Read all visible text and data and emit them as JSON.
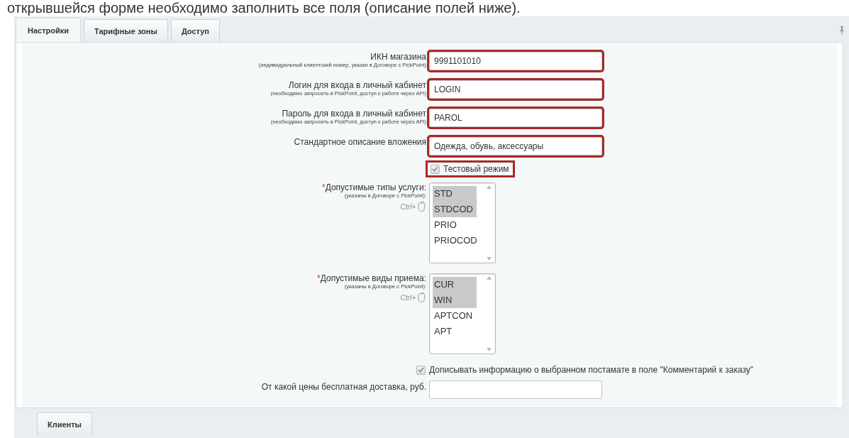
{
  "intro_text": "открывшейся форме необходимо заполнить все поля (описание полей ниже).",
  "tabs": [
    {
      "label": "Настройки",
      "selected": true
    },
    {
      "label": "Тарифные зоны",
      "selected": false
    },
    {
      "label": "Доступ",
      "selected": false
    }
  ],
  "fields": [
    {
      "label": "ИКН магазина",
      "hint": "(индивидуальный клиентский номер, указан в Договоре с PickPoint)",
      "value": "9991101010",
      "highlighted": true
    },
    {
      "label": "Логин для входа в личный кабинет",
      "hint": "(необходимо запросить в PickPoint, доступ к работе через API)",
      "value": "LOGIN",
      "highlighted": true
    },
    {
      "label": "Пароль для входа в личный кабинет",
      "hint": "(необходимо запросить в PickPoint, доступ к работе через API)",
      "value": "PAROL",
      "highlighted": true
    },
    {
      "label": "Стандартное описание вложения",
      "value": "Одежда, обувь, аксессуары",
      "highlighted": true
    }
  ],
  "test_mode": {
    "label": "Тестовый режим",
    "checked": true,
    "highlighted": true
  },
  "lists": [
    {
      "marker": "*",
      "label": "Допустимые типы услуги:",
      "hint": "(указаны в Договоре с PickPoint):",
      "shortcut": "Ctrl+",
      "options": [
        {
          "label": "STD",
          "selected": true
        },
        {
          "label": "STDCOD",
          "selected": true
        },
        {
          "label": "PRIO",
          "selected": false
        },
        {
          "label": "PRIOCOD",
          "selected": false
        }
      ]
    },
    {
      "marker": "*",
      "label": "Допустимые виды приема:",
      "hint": "(указаны в Договоре с PickPoint):",
      "shortcut": "Ctrl+",
      "options": [
        {
          "label": "CUR",
          "selected": true
        },
        {
          "label": "WIN",
          "selected": true
        },
        {
          "label": "APTCON",
          "selected": false
        },
        {
          "label": "APT",
          "selected": false
        }
      ]
    }
  ],
  "comment_option": {
    "label": "Дописывать информацию о выбранном постамате в поле \"Комментарий к заказу\"",
    "checked": true
  },
  "free_delivery": {
    "label": "От какой цены бесплатная доставка, руб."
  },
  "bottom_tabs": [
    {
      "label": "Клиенты",
      "selected": false
    }
  ]
}
